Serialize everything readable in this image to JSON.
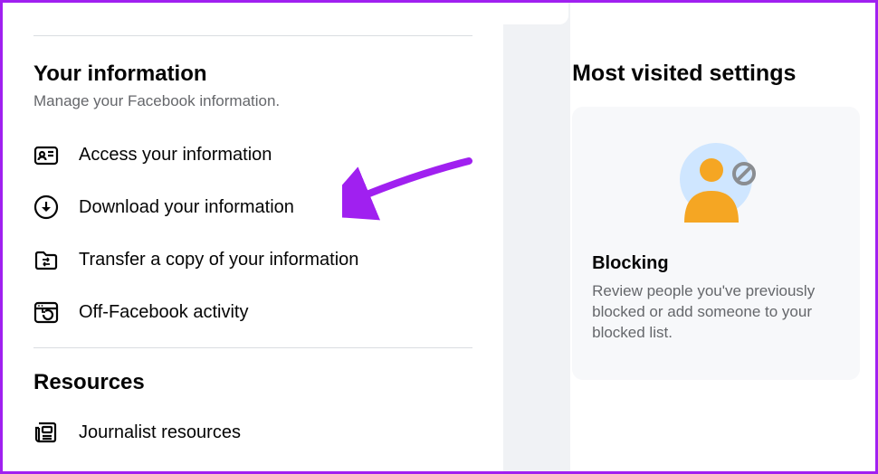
{
  "left": {
    "section_title": "Your information",
    "section_subtitle": "Manage your Facebook information.",
    "items": [
      {
        "label": "Access your information"
      },
      {
        "label": "Download your information"
      },
      {
        "label": "Transfer a copy of your information"
      },
      {
        "label": "Off-Facebook activity"
      }
    ],
    "resources_title": "Resources",
    "resources_items": [
      {
        "label": "Journalist resources"
      }
    ]
  },
  "right": {
    "most_visited_title": "Most visited settings",
    "card": {
      "title": "Blocking",
      "desc": "Review people you've previously blocked or add someone to your blocked list."
    }
  }
}
